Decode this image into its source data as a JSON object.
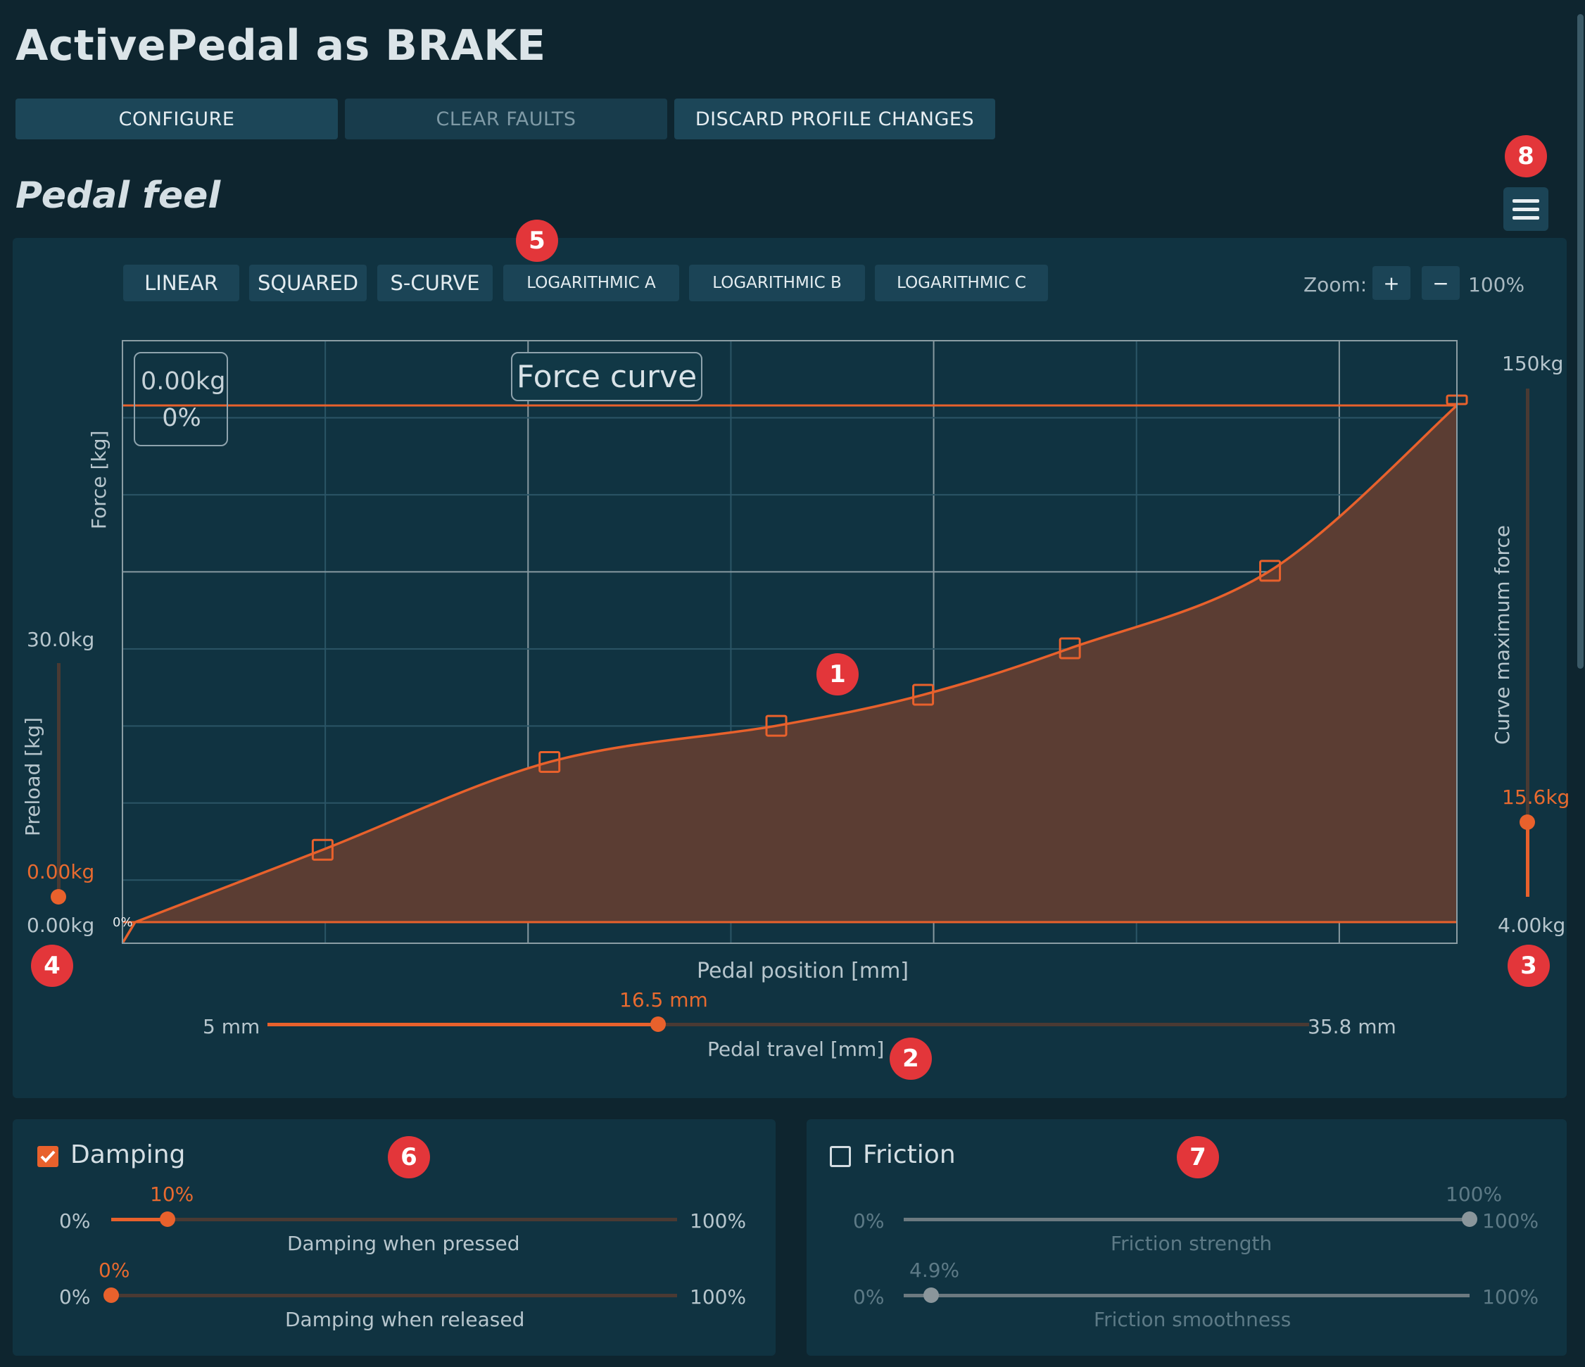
{
  "window": {
    "title": "ActivePedal as BRAKE"
  },
  "toolbar": {
    "configure": "CONFIGURE",
    "clear_faults": "CLEAR FAULTS",
    "discard": "DISCARD PROFILE CHANGES"
  },
  "section": {
    "title": "Pedal feel",
    "menu_icon": "hamburger-menu-icon"
  },
  "presets": [
    "LINEAR",
    "SQUARED",
    "S-CURVE",
    "LOGARITHMIC A",
    "LOGARITHMIC B",
    "LOGARITHMIC C"
  ],
  "zoom": {
    "label": "Zoom:",
    "plus": "+",
    "minus": "−",
    "value": "100%"
  },
  "chart": {
    "title": "Force curve",
    "readout_force": "0.00kg",
    "readout_pct": "0%",
    "y_label": "Force [kg]",
    "x_label": "Pedal position [mm]",
    "zero_label": "0%"
  },
  "chart_data": {
    "type": "area",
    "title": "Force curve",
    "xlabel": "Pedal position [mm]",
    "ylabel": "Force [kg]",
    "xlim": [
      0,
      100
    ],
    "ylim": [
      0,
      100
    ],
    "grid": true,
    "curve_color": "#e8612c",
    "fill_color": "#5b3d33",
    "control_points": [
      {
        "x": 0,
        "y": 0
      },
      {
        "x": 15,
        "y": 14
      },
      {
        "x": 32,
        "y": 31
      },
      {
        "x": 49,
        "y": 38
      },
      {
        "x": 60,
        "y": 44
      },
      {
        "x": 71,
        "y": 53
      },
      {
        "x": 86,
        "y": 68
      },
      {
        "x": 100,
        "y": 100
      }
    ]
  },
  "preload": {
    "label": "Preload [kg]",
    "max": "30.0kg",
    "value": "0.00kg",
    "min": "0.00kg",
    "fraction": 0.0
  },
  "max_force": {
    "label": "Curve maximum force",
    "max": "150kg",
    "value": "15.6kg",
    "min": "4.00kg",
    "fraction": 0.16
  },
  "pedal_travel": {
    "label": "Pedal travel [mm]",
    "min": "5 mm",
    "value": "16.5 mm",
    "max": "35.8 mm",
    "fraction": 0.37
  },
  "damping": {
    "title": "Damping",
    "enabled": true,
    "pressed": {
      "label": "Damping when pressed",
      "min": "0%",
      "max": "100%",
      "value": "10%",
      "fraction": 0.1
    },
    "released": {
      "label": "Damping when released",
      "min": "0%",
      "max": "100%",
      "value": "0%",
      "fraction": 0.0
    }
  },
  "friction": {
    "title": "Friction",
    "enabled": false,
    "strength": {
      "label": "Friction strength",
      "min": "0%",
      "max": "100%",
      "value": "100%",
      "fraction": 1.0
    },
    "smoothness": {
      "label": "Friction smoothness",
      "min": "0%",
      "max": "100%",
      "value": "4.9%",
      "fraction": 0.049
    }
  },
  "badges": [
    "1",
    "2",
    "3",
    "4",
    "5",
    "6",
    "7",
    "8"
  ],
  "colors": {
    "accent": "#e8612c",
    "background": "#0e252f",
    "panel": "#103341",
    "button": "#1b4456",
    "badge": "#e3363a"
  }
}
